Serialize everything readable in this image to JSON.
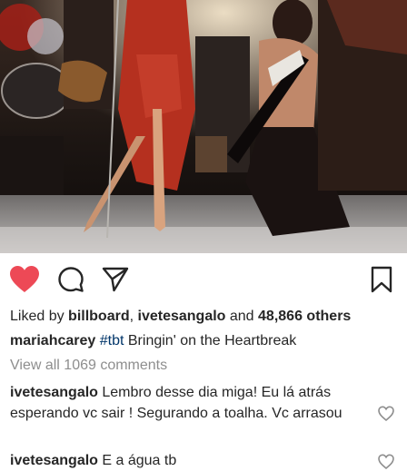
{
  "post": {
    "photo_alt": ""
  },
  "actions": {
    "like_icon": "heart-filled-icon",
    "comment_icon": "comment-bubble-icon",
    "share_icon": "paper-plane-icon",
    "save_icon": "bookmark-icon",
    "like_color": "#ed4956"
  },
  "likes": {
    "prefix": "Liked by ",
    "user1": "billboard",
    "separator": ", ",
    "user2": "ivetesangalo",
    "and": " and ",
    "count": "48,866 others"
  },
  "caption": {
    "username": "mariahcarey",
    "hashtag": "#tbt",
    "text": " Bringin' on the Heartbreak"
  },
  "view_all_comments": "View all 1069 comments",
  "comments": [
    {
      "username": "ivetesangalo",
      "text": " Lembro desse dia miga! Eu lá atrás esperando vc sair ! Segurando a toalha. Vc arrasou"
    },
    {
      "username": "ivetesangalo",
      "text": " E a água tb"
    }
  ]
}
